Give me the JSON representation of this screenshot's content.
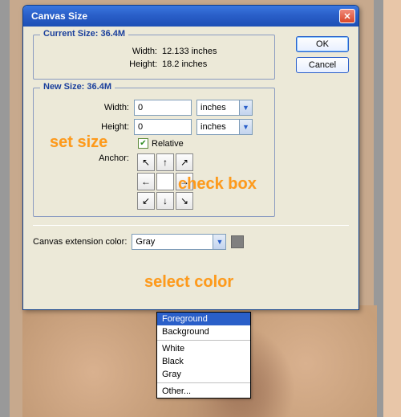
{
  "dialog": {
    "title": "Canvas Size"
  },
  "current": {
    "group_title": "Current Size: 36.4M",
    "width_label": "Width:",
    "width_value": "12.133 inches",
    "height_label": "Height:",
    "height_value": "18.2 inches"
  },
  "newsize": {
    "group_title": "New Size: 36.4M",
    "width_label": "Width:",
    "width_value": "0",
    "width_unit": "inches",
    "height_label": "Height:",
    "height_value": "0",
    "height_unit": "inches",
    "relative_label": "Relative",
    "anchor_label": "Anchor:"
  },
  "ext": {
    "label": "Canvas extension color:",
    "selected": "Gray",
    "options": {
      "foreground": "Foreground",
      "background": "Background",
      "white": "White",
      "black": "Black",
      "gray": "Gray",
      "other": "Other..."
    }
  },
  "buttons": {
    "ok": "OK",
    "cancel": "Cancel"
  },
  "annotations": {
    "set_size": "set size",
    "check_box": "check box",
    "select_color": "select color"
  }
}
